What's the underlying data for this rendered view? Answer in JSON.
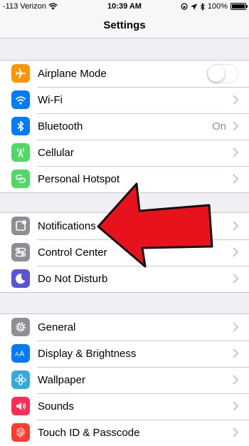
{
  "status": {
    "carrier": "-113 Verizon",
    "time": "10:39 AM",
    "battery": "100%"
  },
  "nav": {
    "title": "Settings"
  },
  "groups": [
    [
      {
        "label": "Airplane Mode",
        "icon": "airplane-icon",
        "color": "#ff9500",
        "toggle": false
      },
      {
        "label": "Wi-Fi",
        "icon": "wifi-icon",
        "color": "#007aff"
      },
      {
        "label": "Bluetooth",
        "icon": "bluetooth-icon",
        "color": "#007aff",
        "detail": "On"
      },
      {
        "label": "Cellular",
        "icon": "cellular-icon",
        "color": "#4cd964"
      },
      {
        "label": "Personal Hotspot",
        "icon": "hotspot-icon",
        "color": "#4cd964"
      }
    ],
    [
      {
        "label": "Notifications",
        "icon": "notifications-icon",
        "color": "#8e8e93"
      },
      {
        "label": "Control Center",
        "icon": "control-center-icon",
        "color": "#8e8e93"
      },
      {
        "label": "Do Not Disturb",
        "icon": "moon-icon",
        "color": "#5856d6"
      }
    ],
    [
      {
        "label": "General",
        "icon": "gear-icon",
        "color": "#8e8e93"
      },
      {
        "label": "Display & Brightness",
        "icon": "display-icon",
        "color": "#007aff"
      },
      {
        "label": "Wallpaper",
        "icon": "wallpaper-icon",
        "color": "#34aadc"
      },
      {
        "label": "Sounds",
        "icon": "speaker-icon",
        "color": "#ff2d55"
      },
      {
        "label": "Touch ID & Passcode",
        "icon": "fingerprint-icon",
        "color": "#ff3b30"
      }
    ]
  ],
  "annotation": {
    "arrow_color": "#e8121c",
    "points_to": "Notifications"
  }
}
